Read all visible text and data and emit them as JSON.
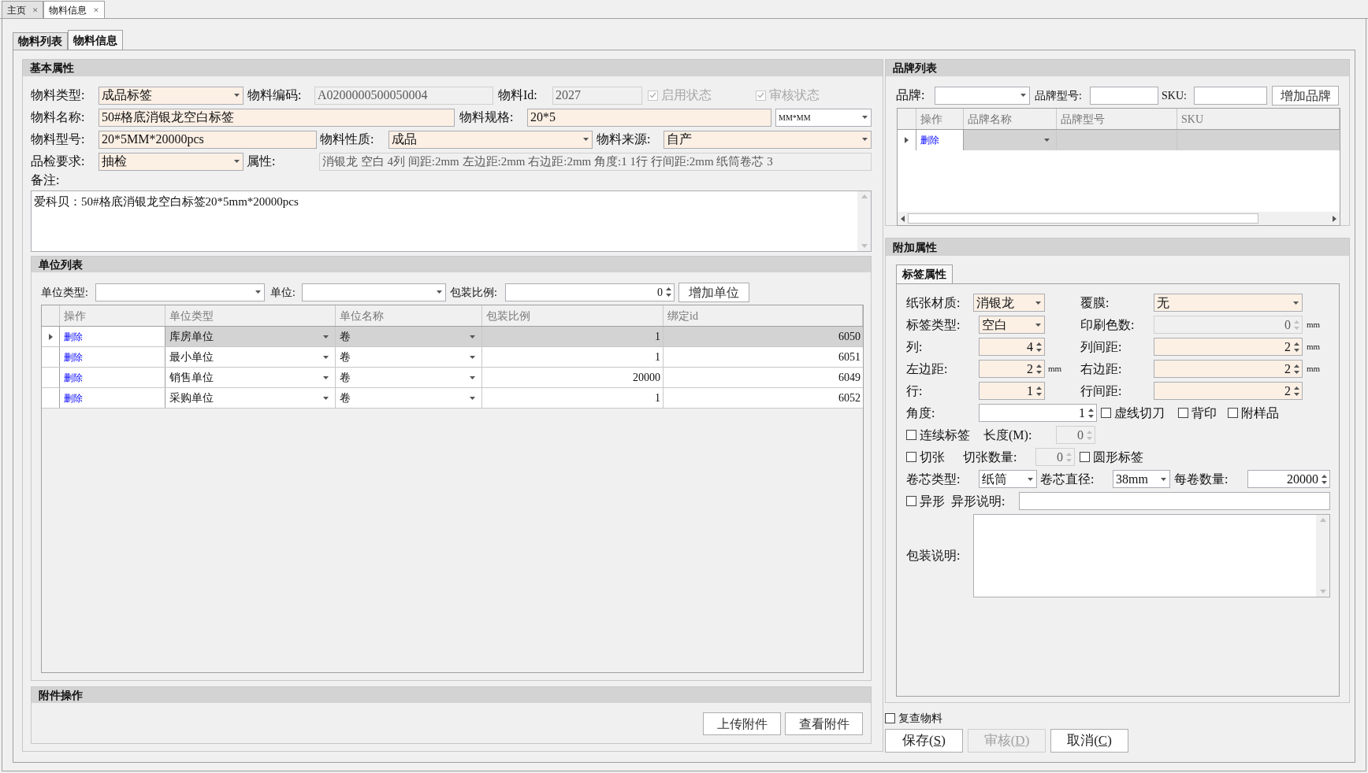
{
  "doc_tabs": [
    {
      "label": "主页",
      "close": "×",
      "selected": false
    },
    {
      "label": "物料信息",
      "close": "×",
      "selected": true
    }
  ],
  "page_tabs": [
    {
      "label": "物料列表",
      "selected": false
    },
    {
      "label": "物料信息",
      "selected": true
    }
  ],
  "basic": {
    "title": "基本属性",
    "rows": [
      {
        "items": [
          {
            "kind": "label",
            "text": "物料类型:"
          },
          {
            "kind": "combo",
            "value": "成品标签",
            "required": true,
            "disabled": false
          },
          {
            "kind": "label",
            "text": "物料编码:"
          },
          {
            "kind": "text",
            "value": "A0200000500050004",
            "disabled": true
          },
          {
            "kind": "label",
            "text": "物料Id:"
          },
          {
            "kind": "text",
            "value": "2027",
            "disabled": true
          },
          {
            "kind": "check",
            "text": "启用状态",
            "checked": true,
            "disabled": true
          },
          {
            "kind": "check",
            "text": "审核状态",
            "checked": true,
            "disabled": true
          }
        ]
      },
      {
        "items": [
          {
            "kind": "label",
            "text": "物料名称:"
          },
          {
            "kind": "text",
            "value": "50#格底消银龙空白标签",
            "required": true,
            "disabled": false
          },
          {
            "kind": "label",
            "text": "物料规格:"
          },
          {
            "kind": "text",
            "value": "20*5",
            "required": true,
            "disabled": false
          },
          {
            "kind": "combo",
            "value": "MM*MM",
            "required": false,
            "disabled": false
          }
        ]
      },
      {
        "items": [
          {
            "kind": "label",
            "text": "物料型号:"
          },
          {
            "kind": "text",
            "value": "20*5MM*20000pcs",
            "required": true,
            "disabled": false
          },
          {
            "kind": "label",
            "text": "物料性质:"
          },
          {
            "kind": "combo",
            "value": "成品",
            "required": true,
            "disabled": false
          },
          {
            "kind": "label",
            "text": "物料来源:"
          },
          {
            "kind": "combo",
            "value": "自产",
            "required": true,
            "disabled": false
          }
        ]
      },
      {
        "items": [
          {
            "kind": "label",
            "text": "品检要求:"
          },
          {
            "kind": "combo",
            "value": "抽检",
            "required": true,
            "disabled": false
          },
          {
            "kind": "label",
            "text": "属性:"
          },
          {
            "kind": "text",
            "value": "消银龙 空白 4列 间距:2mm 左边距:2mm 右边距:2mm 角度:1 1行 行间距:2mm 纸筒卷芯 3",
            "disabled": true
          }
        ]
      }
    ],
    "remark": {
      "label": "备注:",
      "value": "爱科贝：50#格底消银龙空白标签20*5mm*20000pcs"
    }
  },
  "units": {
    "title": "单位列表",
    "toolbar": [
      {
        "kind": "label",
        "text": "单位类型:"
      },
      {
        "kind": "combo",
        "required": false,
        "disabled": false
      },
      {
        "kind": "label",
        "text": "单位:"
      },
      {
        "kind": "combo",
        "required": false,
        "disabled": false
      },
      {
        "kind": "label",
        "text": "包装比例:"
      },
      {
        "kind": "spin",
        "value": "0",
        "required": false,
        "disabled": false
      },
      {
        "kind": "button",
        "text": "增加单位"
      }
    ],
    "columns": [
      "操作",
      "单位类型",
      "单位名称",
      "包装比例",
      "绑定id"
    ],
    "rows": [
      {
        "selected": true,
        "action": "删除",
        "type": "库房单位",
        "name": "卷",
        "ratio": "1",
        "id": "6050"
      },
      {
        "selected": false,
        "action": "删除",
        "type": "最小单位",
        "name": "卷",
        "ratio": "1",
        "id": "6051"
      },
      {
        "selected": false,
        "action": "删除",
        "type": "销售单位",
        "name": "卷",
        "ratio": "20000",
        "id": "6049"
      },
      {
        "selected": false,
        "action": "删除",
        "type": "采购单位",
        "name": "卷",
        "ratio": "1",
        "id": "6052"
      }
    ]
  },
  "attachments": {
    "title": "附件操作",
    "buttons": [
      "上传附件",
      "查看附件"
    ]
  },
  "brands": {
    "title": "品牌列表",
    "toolbar": [
      {
        "kind": "label",
        "text": "品牌:"
      },
      {
        "kind": "combo",
        "required": false,
        "disabled": false
      },
      {
        "kind": "label",
        "text": "品牌型号:"
      },
      {
        "kind": "text",
        "required": false,
        "disabled": false
      },
      {
        "kind": "label",
        "text": "SKU:"
      },
      {
        "kind": "text",
        "required": false,
        "disabled": false
      },
      {
        "kind": "button",
        "text": "增加品牌"
      }
    ],
    "columns": [
      "操作",
      "品牌名称",
      "品牌型号",
      "SKU"
    ],
    "rows": [
      {
        "selected": true,
        "action": "删除"
      }
    ]
  },
  "extra": {
    "title": "附加属性",
    "tabs": [
      {
        "label": "标签属性",
        "selected": true
      }
    ],
    "rows": [
      {
        "items": [
          {
            "kind": "label",
            "text": "纸张材质:"
          },
          {
            "kind": "combo",
            "value": "消银龙",
            "required": true,
            "disabled": false
          },
          {
            "kind": "label",
            "text": "覆膜:"
          },
          {
            "kind": "combo",
            "value": "无",
            "required": true,
            "disabled": false
          }
        ]
      },
      {
        "items": [
          {
            "kind": "label",
            "text": "标签类型:"
          },
          {
            "kind": "combo",
            "value": "空白",
            "required": true,
            "disabled": false
          },
          {
            "kind": "label",
            "text": "印刷色数:"
          },
          {
            "kind": "spin",
            "value": "0",
            "disabled": true
          },
          {
            "kind": "unit",
            "text": "mm"
          }
        ]
      },
      {
        "items": [
          {
            "kind": "label",
            "text": "列:"
          },
          {
            "kind": "spin",
            "value": "4",
            "required": true,
            "disabled": false
          },
          {
            "kind": "label",
            "text": "列间距:"
          },
          {
            "kind": "spin",
            "value": "2",
            "required": true,
            "disabled": false
          },
          {
            "kind": "unit",
            "text": "mm"
          }
        ]
      },
      {
        "items": [
          {
            "kind": "label",
            "text": "左边距:"
          },
          {
            "kind": "spin",
            "value": "2",
            "required": true,
            "disabled": false
          },
          {
            "kind": "unit",
            "text": "mm"
          },
          {
            "kind": "label",
            "text": "右边距:"
          },
          {
            "kind": "spin",
            "value": "2",
            "required": true,
            "disabled": false
          },
          {
            "kind": "unit",
            "text": "mm"
          }
        ]
      },
      {
        "items": [
          {
            "kind": "label",
            "text": "行:"
          },
          {
            "kind": "spin",
            "value": "1",
            "required": true,
            "disabled": false
          },
          {
            "kind": "label",
            "text": "行间距:"
          },
          {
            "kind": "spin",
            "value": "2",
            "required": true,
            "disabled": false
          }
        ]
      },
      {
        "items": [
          {
            "kind": "label",
            "text": "角度:"
          },
          {
            "kind": "spin",
            "value": "1",
            "required": false,
            "disabled": false
          },
          {
            "kind": "check",
            "text": "虚线切刀",
            "checked": false,
            "disabled": false
          },
          {
            "kind": "check",
            "text": "背印",
            "checked": false,
            "disabled": false
          },
          {
            "kind": "check",
            "text": "附样品",
            "checked": false,
            "disabled": false
          }
        ]
      },
      {
        "items": [
          {
            "kind": "check",
            "text": "连续标签",
            "checked": false,
            "disabled": false
          },
          {
            "kind": "label",
            "text": "长度(M):"
          },
          {
            "kind": "spin",
            "value": "0",
            "disabled": true
          }
        ]
      },
      {
        "items": [
          {
            "kind": "check",
            "text": "切张",
            "checked": false,
            "disabled": false
          },
          {
            "kind": "label",
            "text": "切张数量:"
          },
          {
            "kind": "spin",
            "value": "0",
            "disabled": true
          },
          {
            "kind": "check",
            "text": "圆形标签",
            "checked": false,
            "disabled": false
          }
        ]
      },
      {
        "items": [
          {
            "kind": "label",
            "text": "卷芯类型:"
          },
          {
            "kind": "combo",
            "value": "纸筒",
            "required": false,
            "disabled": false
          },
          {
            "kind": "label",
            "text": "卷芯直径:"
          },
          {
            "kind": "combo",
            "value": "38mm",
            "required": false,
            "disabled": false
          },
          {
            "kind": "label",
            "text": "每卷数量:"
          },
          {
            "kind": "spin",
            "value": "20000",
            "required": false,
            "disabled": false
          }
        ]
      },
      {
        "items": [
          {
            "kind": "check",
            "text": "异形",
            "checked": false,
            "disabled": false
          },
          {
            "kind": "label",
            "text": "异形说明:"
          },
          {
            "kind": "text",
            "required": false,
            "disabled": false
          }
        ]
      }
    ],
    "packing": {
      "label": "包装说明:"
    }
  },
  "review": {
    "text": "复查物料",
    "checked": false
  },
  "actions": [
    {
      "prefix": "保存(",
      "key": "S",
      "suffix": ")",
      "disabled": false
    },
    {
      "prefix": "审核(",
      "key": "D",
      "suffix": ")",
      "disabled": true
    },
    {
      "prefix": "取消(",
      "key": "C",
      "suffix": ")",
      "disabled": false
    }
  ]
}
